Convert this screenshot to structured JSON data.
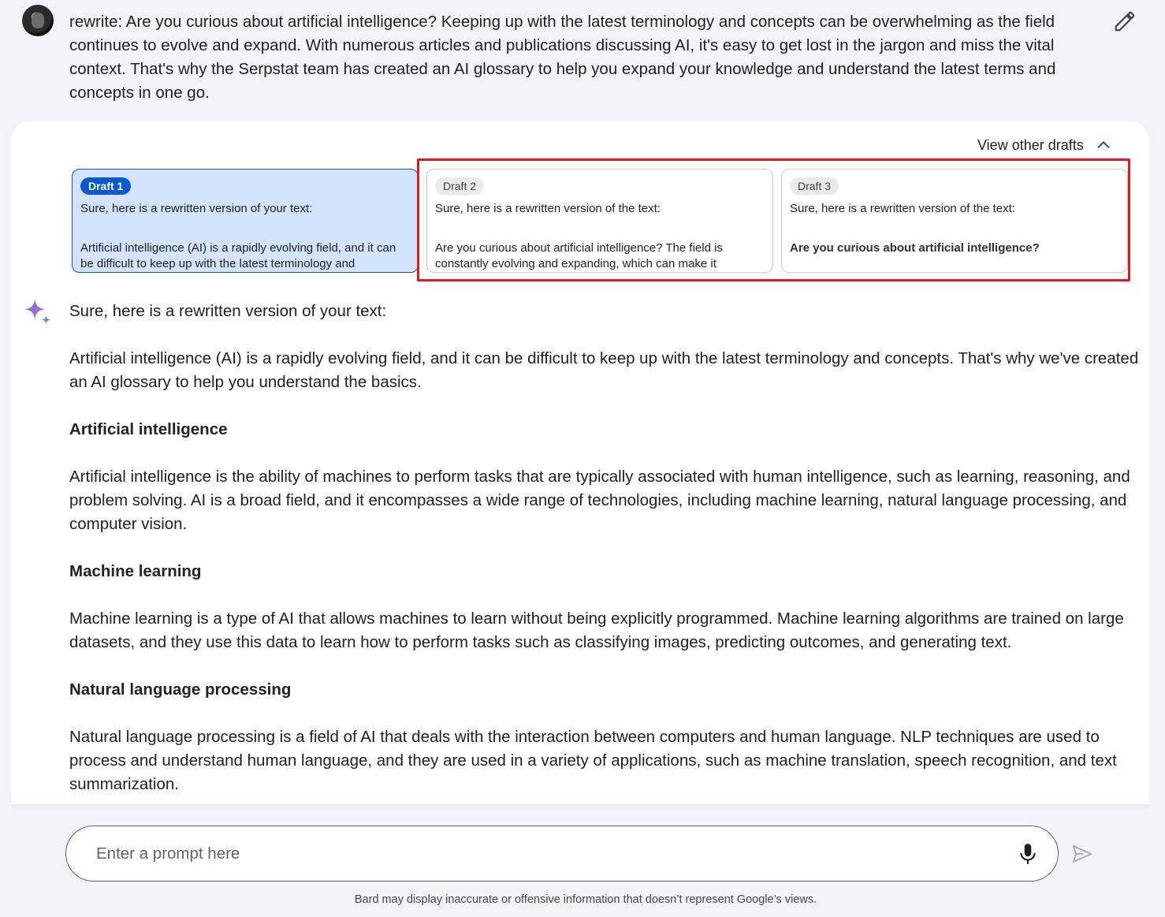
{
  "user_prompt": "rewrite: Are you curious about artificial intelligence? Keeping up with the latest terminology and concepts can be overwhelming as the field continues to evolve and expand. With numerous articles and publications discussing AI, it's easy to get lost in the jargon and miss the vital context. That's why the Serpstat team has created an AI glossary to help you expand your knowledge and understand the latest terms and concepts in one go.",
  "drafts_toggle_label": "View other drafts",
  "drafts": [
    {
      "label": "Draft 1",
      "intro": "Sure, here is a rewritten version of your text:",
      "preview": "Artificial intelligence (AI) is a rapidly evolving field, and it can be difficult to keep up with the latest terminology and",
      "selected": true
    },
    {
      "label": "Draft 2",
      "intro": "Sure, here is a rewritten version of the text:",
      "preview": "Are you curious about artificial intelligence? The field is constantly evolving and expanding, which can make it",
      "selected": false
    },
    {
      "label": "Draft 3",
      "intro": "Sure, here is a rewritten version of the text:",
      "preview": "Are you curious about artificial intelligence?",
      "selected": false
    }
  ],
  "response": {
    "intro": "Sure, here is a rewritten version of your text:",
    "lead": "Artificial intelligence (AI) is a rapidly evolving field, and it can be difficult to keep up with the latest terminology and concepts. That's why we've created an AI glossary to help you understand the basics.",
    "sections": [
      {
        "heading": "Artificial intelligence",
        "body": "Artificial intelligence is the ability of machines to perform tasks that are typically associated with human intelligence, such as learning, reasoning, and problem solving. AI is a broad field, and it encompasses a wide range of technologies, including machine learning, natural language processing, and computer vision."
      },
      {
        "heading": "Machine learning",
        "body": "Machine learning is a type of AI that allows machines to learn without being explicitly programmed. Machine learning algorithms are trained on large datasets, and they use this data to learn how to perform tasks such as classifying images, predicting outcomes, and generating text."
      },
      {
        "heading": "Natural language processing",
        "body": "Natural language processing is a field of AI that deals with the interaction between computers and human language. NLP techniques are used to process and understand human language, and they are used in a variety of applications, such as machine translation, speech recognition, and text summarization."
      }
    ]
  },
  "input": {
    "placeholder": "Enter a prompt here",
    "value": ""
  },
  "disclaimer": "Bard may display inaccurate or offensive information that doesn’t represent Google’s views.",
  "colors": {
    "page_bg": "#f0f4f9",
    "selected_draft_bg": "#d3e3fd",
    "accent_blue": "#0b57d0",
    "highlight_red": "#d91b24"
  },
  "icons": {
    "avatar": "user-avatar",
    "edit": "pencil-icon",
    "toggle": "chevron-up-icon",
    "bard": "sparkle-icon",
    "mic": "microphone-icon",
    "send": "send-icon"
  }
}
